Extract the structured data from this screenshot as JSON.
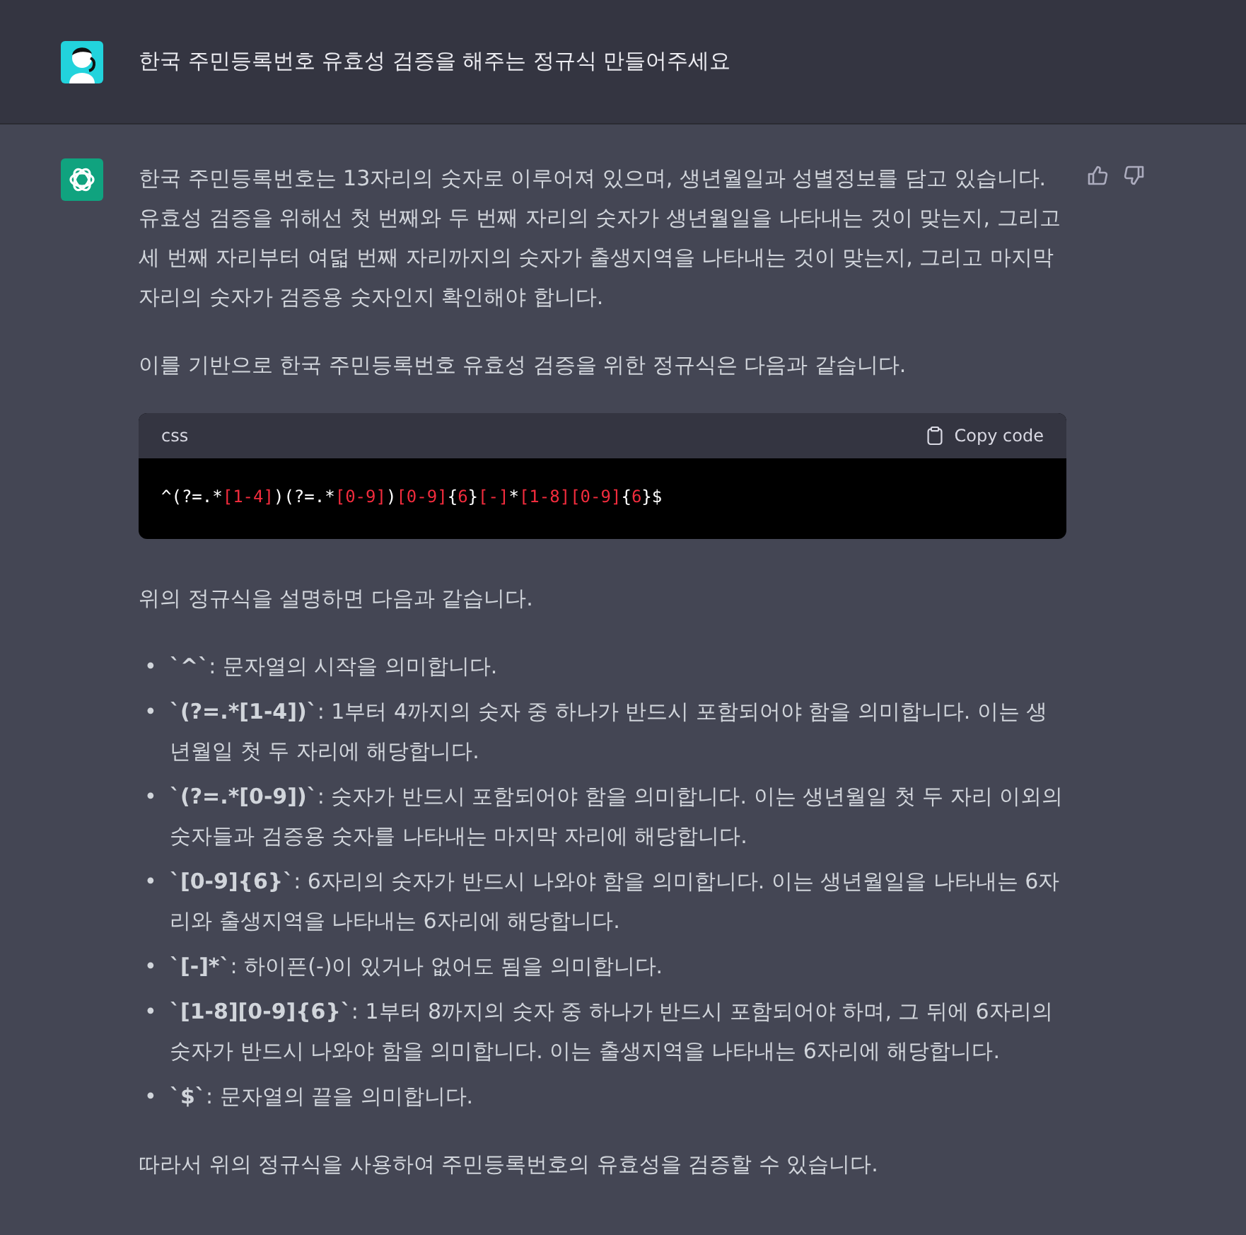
{
  "user_message": {
    "text": "한국 주민등록번호 유효성 검증을 해주는 정규식 만들어주세요"
  },
  "assistant_message": {
    "intro": [
      "한국 주민등록번호는 13자리의 숫자로 이루어져 있으며, 생년월일과 성별정보를 담고 있습니다. 유효성 검증을 위해선 첫 번째와 두 번째 자리의 숫자가 생년월일을 나타내는 것이 맞는지, 그리고 세 번째 자리부터 여덟 번째 자리까지의 숫자가 출생지역을 나타내는 것이 맞는지, 그리고 마지막 자리의 숫자가 검증용 숫자인지 확인해야 합니다.",
      "이를 기반으로 한국 주민등록번호 유효성 검증을 위한 정규식은 다음과 같습니다."
    ],
    "code_block": {
      "language": "css",
      "copy_label": "Copy code",
      "tokens": [
        {
          "text": "^(?=.*",
          "kind": "punct"
        },
        {
          "text": "[1-4]",
          "kind": "class"
        },
        {
          "text": ")(?=.*",
          "kind": "punct"
        },
        {
          "text": "[0-9]",
          "kind": "class"
        },
        {
          "text": ")",
          "kind": "punct"
        },
        {
          "text": "[0-9]",
          "kind": "class"
        },
        {
          "text": "{",
          "kind": "punct"
        },
        {
          "text": "6",
          "kind": "class"
        },
        {
          "text": "}",
          "kind": "punct"
        },
        {
          "text": "[-]",
          "kind": "class"
        },
        {
          "text": "*",
          "kind": "punct"
        },
        {
          "text": "[1-8]",
          "kind": "class"
        },
        {
          "text": "[0-9]",
          "kind": "class"
        },
        {
          "text": "{",
          "kind": "punct"
        },
        {
          "text": "6",
          "kind": "class"
        },
        {
          "text": "}$",
          "kind": "punct"
        }
      ]
    },
    "explanation_intro": "위의 정규식을 설명하면 다음과 같습니다.",
    "bullets": [
      {
        "marker": "•",
        "text": "**`^`**: 문자열의 시작을 의미합니다."
      },
      {
        "marker": "•",
        "text": "**`(?=.*[1-4])`**: 1부터 4까지의 숫자 중 하나가 반드시 포함되어야 함을 의미합니다. 이는 생년월일 첫 두 자리에 해당합니다."
      },
      {
        "marker": "•",
        "text": "**`(?=.*[0-9])`**: 숫자가 반드시 포함되어야 함을 의미합니다. 이는 생년월일 첫 두 자리 이외의 숫자들과 검증용 숫자를 나타내는 마지막 자리에 해당합니다."
      },
      {
        "marker": "•",
        "text": "**`[0-9]{6}`**: 6자리의 숫자가 반드시 나와야 함을 의미합니다. 이는 생년월일을 나타내는 6자리와 출생지역을 나타내는 6자리에 해당합니다."
      },
      {
        "marker": "•",
        "text": "**`[-]*`**: 하이픈(-)이 있거나 없어도 됨을 의미합니다."
      },
      {
        "marker": "•",
        "text": "**`[1-8][0-9]{6}`**: 1부터 8까지의 숫자 중 하나가 반드시 포함되어야 하며, 그 뒤에 6자리의 숫자가 반드시 나와야 함을 의미합니다. 이는 출생지역을 나타내는 6자리에 해당합니다."
      },
      {
        "marker": "•",
        "text": "**`$`**: 문자열의 끝을 의미합니다."
      }
    ],
    "conclusion": "따라서 위의 정규식을 사용하여 주민등록번호의 유효성을 검증할 수 있습니다."
  }
}
